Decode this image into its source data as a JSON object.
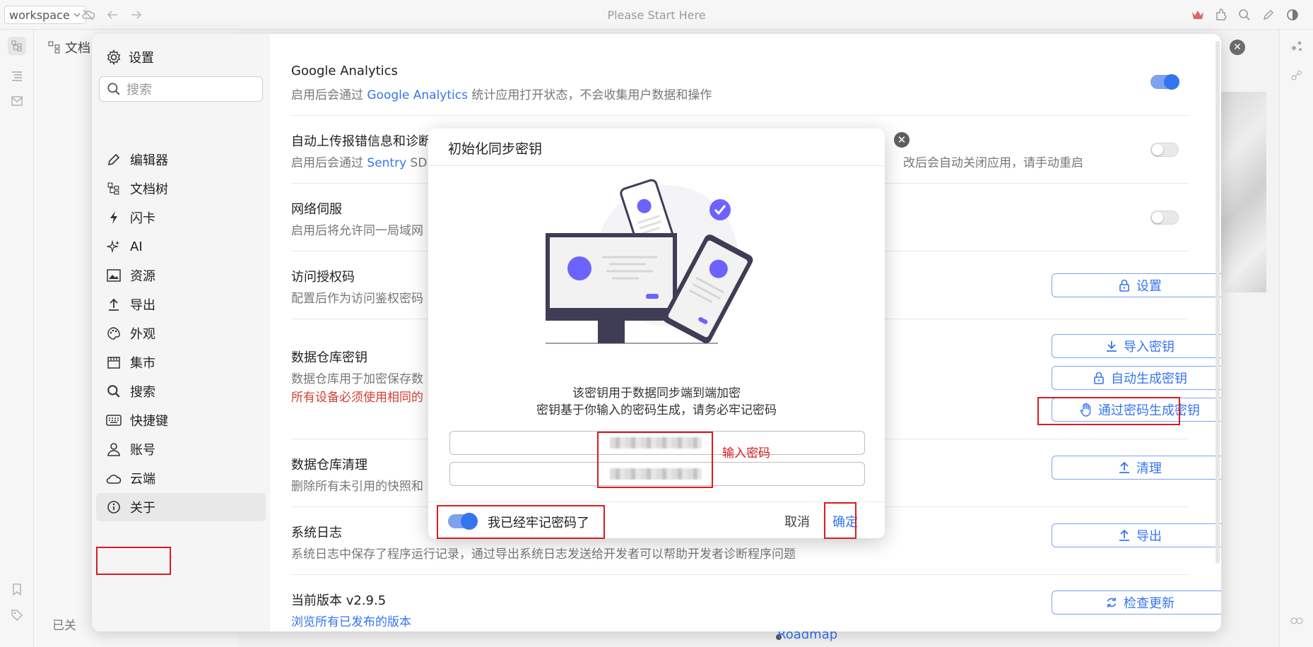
{
  "topbar": {
    "workspace": "workspace",
    "center_title": "Please Start Here"
  },
  "background": {
    "doc_tree_title": "文档",
    "footer": "已关",
    "roadmap": "Roadmap"
  },
  "settings": {
    "title": "设置",
    "search_placeholder": "搜索",
    "nav": [
      {
        "label": "编辑器",
        "icon": "pencil-icon"
      },
      {
        "label": "文档树",
        "icon": "doc-tree-icon"
      },
      {
        "label": "闪卡",
        "icon": "lightning-icon"
      },
      {
        "label": "AI",
        "icon": "sparkle-icon"
      },
      {
        "label": "资源",
        "icon": "image-icon"
      },
      {
        "label": "导出",
        "icon": "upload-icon"
      },
      {
        "label": "外观",
        "icon": "palette-icon"
      },
      {
        "label": "集市",
        "icon": "store-icon"
      },
      {
        "label": "搜索",
        "icon": "search-icon"
      },
      {
        "label": "快捷键",
        "icon": "keyboard-icon"
      },
      {
        "label": "账号",
        "icon": "user-icon"
      },
      {
        "label": "云端",
        "icon": "cloud-icon"
      },
      {
        "label": "关于",
        "icon": "info-icon"
      }
    ],
    "rows": {
      "ga": {
        "title": "Google Analytics",
        "desc_pre": "启用后会通过 ",
        "desc_link": "Google Analytics",
        "desc_post": " 统计应用打开状态，不会收集用户数据和操作",
        "enabled": true
      },
      "error_report": {
        "title": "自动上传报错信息和诊断",
        "desc_pre": "启用后会通过 ",
        "desc_link": "Sentry",
        "desc_post": " SD",
        "desc_tail": "改后会自动关闭应用，请手动重启",
        "enabled": false
      },
      "network_serve": {
        "title": "网络伺服",
        "desc": "启用后将允许同一局域网",
        "enabled": false
      },
      "access_code": {
        "title": "访问授权码",
        "desc": "配置后作为访问鉴权密码",
        "button": "设置"
      },
      "repo_key": {
        "title": "数据仓库密钥",
        "desc": "数据仓库用于加密保存数",
        "warn": "所有设备必须使用相同的",
        "btn_import": "导入密钥",
        "btn_auto": "自动生成密钥",
        "btn_password": "通过密码生成密钥"
      },
      "repo_purge": {
        "title": "数据仓库清理",
        "desc": "删除所有未引用的快照和",
        "button": "清理"
      },
      "system_log": {
        "title": "系统日志",
        "desc": "系统日志中保存了程序运行记录，通过导出系统日志发送给开发者可以帮助开发者诊断程序问题",
        "button": "导出"
      },
      "version": {
        "title": "当前版本 v2.9.5",
        "desc": "浏览所有已发布的版本",
        "button": "检查更新"
      }
    }
  },
  "modal": {
    "title": "初始化同步密钥",
    "desc_line1": "该密钥用于数据同步端到端加密",
    "desc_line2": "密钥基于你输入的密码生成，请务必牢记密码",
    "password_value": "••••••••••",
    "password_confirm_value": "••••••••••",
    "remember_label": "我已经牢记密码了",
    "remember_checked": true,
    "cancel": "取消",
    "confirm": "确定",
    "accent_color": "#6c63ff"
  },
  "annotations": {
    "password_note": "输入密码"
  },
  "colors": {
    "accent": "#3574f0",
    "warning": "#d23f31",
    "annotation": "#d91b24"
  }
}
